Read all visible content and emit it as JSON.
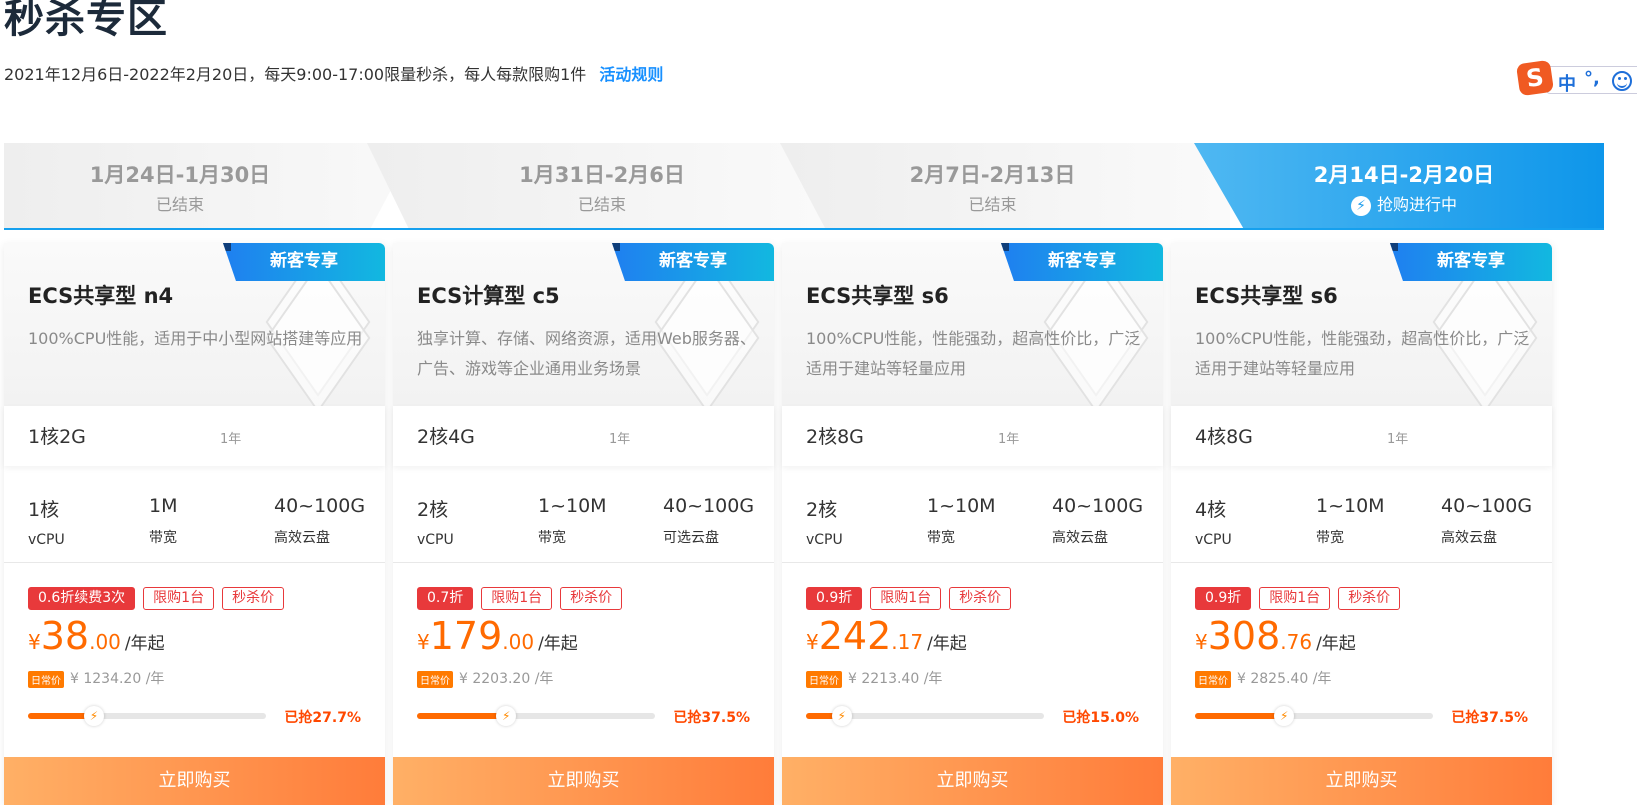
{
  "page": {
    "title": "秒杀专区",
    "subtitle": "2021年12月6日-2022年2月20日，每天9:00-17:00限量秒杀，每人每款限购1件",
    "rules_link": "活动规则"
  },
  "ime": {
    "logo": "S",
    "mode": "中",
    "punct": "°,"
  },
  "tabs": [
    {
      "date": "1月24日-1月30日",
      "status": "已结束"
    },
    {
      "date": "1月31日-2月6日",
      "status": "已结束"
    },
    {
      "date": "2月7日-2月13日",
      "status": "已结束"
    },
    {
      "date": "2月14日-2月20日",
      "status": "抢购进行中",
      "active": true
    }
  ],
  "cards": [
    {
      "badge": "新客专享",
      "title": "ECS共享型 n4",
      "desc": "100%CPU性能，适用于中小型网站搭建等应用",
      "config": "1核2G",
      "period": "1年",
      "specs": [
        {
          "value": "1核",
          "label": "vCPU"
        },
        {
          "value": "1M",
          "label": "带宽"
        },
        {
          "value": "40~100G",
          "label": "高效云盘"
        }
      ],
      "tags": [
        "0.6折续费3次",
        "限购1台",
        "秒杀价"
      ],
      "price_symbol": "¥",
      "price_int": "38",
      "price_dec": ".00",
      "price_unit": "/年起",
      "regular_label": "日常价",
      "regular_price": "¥ 1234.20 /年",
      "progress_percent": 27.7,
      "sold_text": "已抢27.7%",
      "buy_label": "立即购买"
    },
    {
      "badge": "新客专享",
      "title": "ECS计算型 c5",
      "desc": "独享计算、存储、网络资源，适用Web服务器、广告、游戏等企业通用业务场景",
      "config": "2核4G",
      "period": "1年",
      "specs": [
        {
          "value": "2核",
          "label": "vCPU"
        },
        {
          "value": "1~10M",
          "label": "带宽"
        },
        {
          "value": "40~100G",
          "label": "可选云盘"
        }
      ],
      "tags": [
        "0.7折",
        "限购1台",
        "秒杀价"
      ],
      "price_symbol": "¥",
      "price_int": "179",
      "price_dec": ".00",
      "price_unit": "/年起",
      "regular_label": "日常价",
      "regular_price": "¥ 2203.20 /年",
      "progress_percent": 37.5,
      "sold_text": "已抢37.5%",
      "buy_label": "立即购买"
    },
    {
      "badge": "新客专享",
      "title": "ECS共享型 s6",
      "desc": "100%CPU性能，性能强劲，超高性价比，广泛适用于建站等轻量应用",
      "config": "2核8G",
      "period": "1年",
      "specs": [
        {
          "value": "2核",
          "label": "vCPU"
        },
        {
          "value": "1~10M",
          "label": "带宽"
        },
        {
          "value": "40~100G",
          "label": "高效云盘"
        }
      ],
      "tags": [
        "0.9折",
        "限购1台",
        "秒杀价"
      ],
      "price_symbol": "¥",
      "price_int": "242",
      "price_dec": ".17",
      "price_unit": "/年起",
      "regular_label": "日常价",
      "regular_price": "¥ 2213.40 /年",
      "progress_percent": 15.0,
      "sold_text": "已抢15.0%",
      "buy_label": "立即购买"
    },
    {
      "badge": "新客专享",
      "title": "ECS共享型 s6",
      "desc": "100%CPU性能，性能强劲，超高性价比，广泛适用于建站等轻量应用",
      "config": "4核8G",
      "period": "1年",
      "specs": [
        {
          "value": "4核",
          "label": "vCPU"
        },
        {
          "value": "1~10M",
          "label": "带宽"
        },
        {
          "value": "40~100G",
          "label": "高效云盘"
        }
      ],
      "tags": [
        "0.9折",
        "限购1台",
        "秒杀价"
      ],
      "price_symbol": "¥",
      "price_int": "308",
      "price_dec": ".76",
      "price_unit": "/年起",
      "regular_label": "日常价",
      "regular_price": "¥ 2825.40 /年",
      "progress_percent": 37.5,
      "sold_text": "已抢37.5%",
      "buy_label": "立即购买"
    }
  ],
  "colors": {
    "accent_blue": "#16a0ee",
    "price_orange": "#ff6a00",
    "tag_red": "#e8393b"
  }
}
